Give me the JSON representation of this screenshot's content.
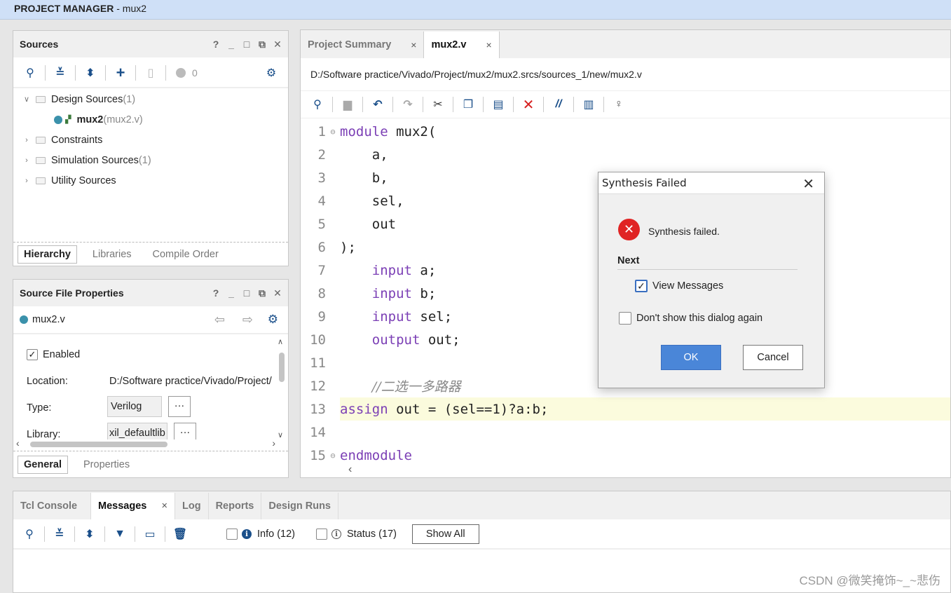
{
  "window": {
    "title_bold": "PROJECT MANAGER",
    "title_rest": " - mux2"
  },
  "sources": {
    "title": "Sources",
    "badge_count": "0",
    "tree": {
      "design": {
        "label": "Design Sources",
        "count": " (1)"
      },
      "mux2": {
        "label": "mux2",
        "file": " (mux2.v)"
      },
      "constraints": {
        "label": "Constraints"
      },
      "simulation": {
        "label": "Simulation Sources",
        "count": " (1)"
      },
      "utility": {
        "label": "Utility Sources"
      }
    },
    "tabs": [
      "Hierarchy",
      "Libraries",
      "Compile Order"
    ]
  },
  "props": {
    "title": "Source File Properties",
    "file": "mux2.v",
    "enabled_label": "Enabled",
    "location_label": "Location:",
    "location_value": "D:/Software practice/Vivado/Project/",
    "type_label": "Type:",
    "type_value": "Verilog",
    "library_label": "Library:",
    "library_value": "xil_defaultlib",
    "more": "···",
    "tabs": [
      "General",
      "Properties"
    ]
  },
  "editor": {
    "tabs": [
      "Project Summary",
      "mux2.v"
    ],
    "close": "×",
    "path": "D:/Software practice/Vivado/Project/mux2/mux2.srcs/sources_1/new/mux2.v",
    "lines": {
      "l1": {
        "n": "1",
        "kw": "module",
        "rest": " mux2("
      },
      "l2": {
        "n": "2",
        "text": "    a,"
      },
      "l3": {
        "n": "3",
        "text": "    b,"
      },
      "l4": {
        "n": "4",
        "text": "    sel,"
      },
      "l5": {
        "n": "5",
        "text": "    out"
      },
      "l6": {
        "n": "6",
        "text": ");"
      },
      "l7": {
        "n": "7",
        "kw": "input",
        "rest": " a;"
      },
      "l8": {
        "n": "8",
        "kw": "input",
        "rest": " b;"
      },
      "l9": {
        "n": "9",
        "kw": "input",
        "rest": " sel;"
      },
      "l10": {
        "n": "10",
        "kw": "output",
        "rest": " out;"
      },
      "l11": {
        "n": "11"
      },
      "l12": {
        "n": "12",
        "comment": "//二选一多路器"
      },
      "l13": {
        "n": "13",
        "kw": "assign",
        "rest": " out = (sel==1)?a:b;"
      },
      "l14": {
        "n": "14"
      },
      "l15": {
        "n": "15",
        "kw": "endmodule"
      }
    }
  },
  "messages": {
    "tabs": [
      "Tcl Console",
      "Messages",
      "Log",
      "Reports",
      "Design Runs"
    ],
    "close": "×",
    "info_label": "Info (12)",
    "status_label": "Status (17)",
    "show_all": "Show All"
  },
  "dialog": {
    "title": "Synthesis Failed",
    "message": "Synthesis failed.",
    "next_label": "Next",
    "view_messages": "View Messages",
    "dont_show": "Don't show this dialog again",
    "ok": "OK",
    "cancel": "Cancel"
  },
  "watermark": "CSDN @微笑掩饰~_~悲伤",
  "colors": {
    "keyword": "#7b3fb5",
    "highlight": "#fbfbdd",
    "ok_button": "#4a86d8",
    "error": "#e02424"
  }
}
